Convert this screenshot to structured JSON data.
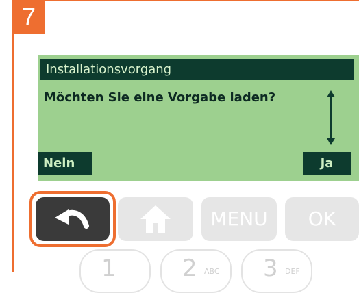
{
  "step": {
    "number": "7"
  },
  "screen": {
    "title": "Installationsvorgang",
    "question": "Möchten Sie eine Vorgabe laden?",
    "softkey_left": "Nein",
    "softkey_right": "Ja"
  },
  "buttons": {
    "back_icon": "back-arrow-icon",
    "home_icon": "home-icon",
    "menu_label": "MENU",
    "ok_label": "OK"
  },
  "keypad": {
    "keys": [
      {
        "num": "1",
        "letters": ""
      },
      {
        "num": "2",
        "letters": "ABC"
      },
      {
        "num": "3",
        "letters": "DEF"
      }
    ]
  },
  "colors": {
    "accent": "#ee6e30",
    "lcd_bg": "#9dd08f",
    "lcd_dark": "#0d3b2e",
    "button_grey": "#e6e6e6",
    "back_button": "#3a3a3a"
  }
}
